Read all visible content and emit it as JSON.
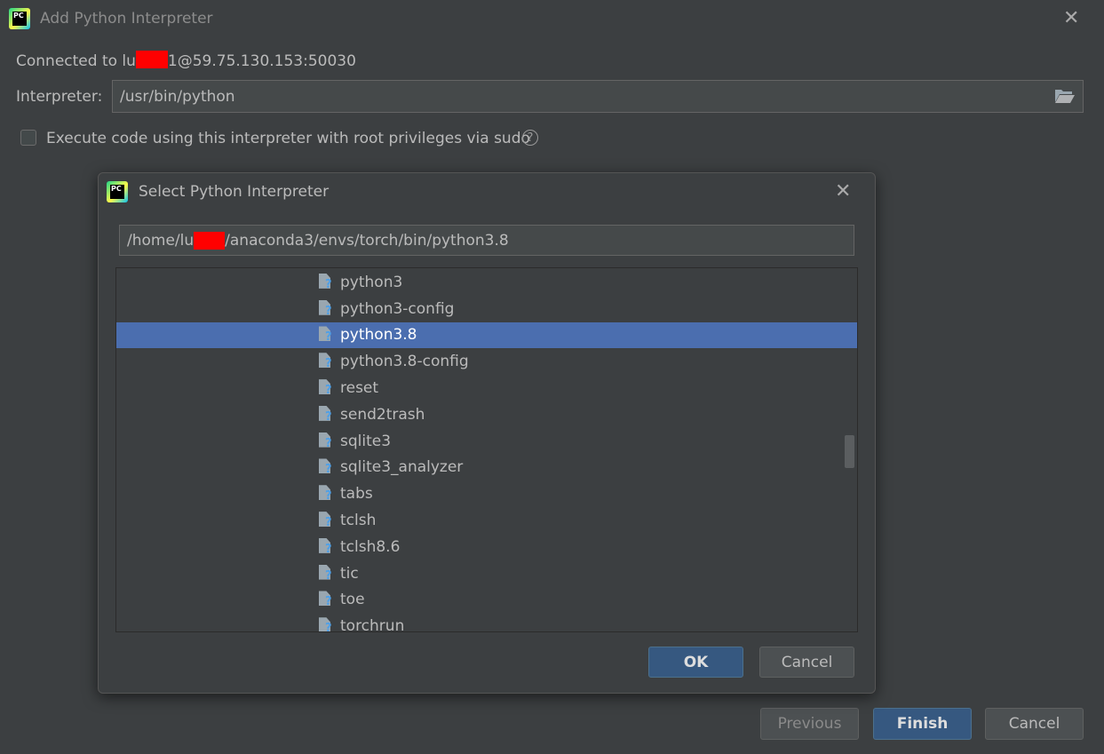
{
  "outer": {
    "logo_text": "PC",
    "title": "Add Python Interpreter",
    "connected_prefix": "Connected to lu",
    "connected_suffix": "1@59.75.130.153:50030",
    "interpreter_label": "Interpreter:",
    "interpreter_value": "/usr/bin/python",
    "sudo_label": "Execute code using this interpreter with root privileges via sudo",
    "help_glyph": "?",
    "buttons": {
      "previous": "Previous",
      "finish": "Finish",
      "cancel": "Cancel"
    }
  },
  "inner": {
    "logo_text": "PC",
    "title": "Select Python Interpreter",
    "path_prefix": "/home/lu",
    "path_suffix": "/anaconda3/envs/torch/bin/python3.8",
    "files": [
      "python3",
      "python3-config",
      "python3.8",
      "python3.8-config",
      "reset",
      "send2trash",
      "sqlite3",
      "sqlite3_analyzer",
      "tabs",
      "tclsh",
      "tclsh8.6",
      "tic",
      "toe",
      "torchrun"
    ],
    "selected_file": "python3.8",
    "buttons": {
      "ok": "OK",
      "cancel": "Cancel"
    }
  },
  "icons": {
    "close": "close-icon",
    "folder": "folder-open-icon",
    "file": "unknown-file-icon",
    "help": "help-icon"
  },
  "colors": {
    "background": "#3c3f41",
    "selection": "#4b6eaf",
    "primary_button": "#365880",
    "redaction": "#ff0000"
  }
}
